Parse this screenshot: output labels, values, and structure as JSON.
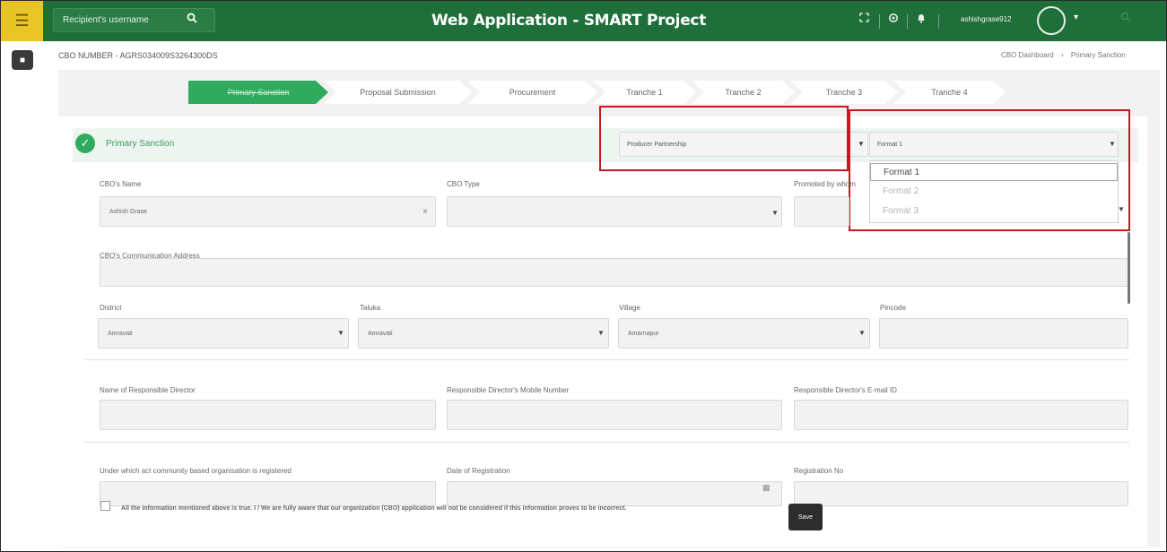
{
  "header": {
    "menu_icon": "hamburger-icon",
    "search_placeholder": "Recipient's username",
    "search_icon": "search-icon",
    "title": "Web Application - SMART Project",
    "icons": [
      "expand-icon",
      "settings-icon",
      "bell-icon"
    ],
    "username": "ashishgrase912",
    "brand_color": "#1f6f3a",
    "accent_color": "#e8c424"
  },
  "page": {
    "cbo_number": "CBO NUMBER - AGRS034009S3264300DS",
    "breadcrumb": [
      "CBO Dashboard",
      "Primary Sanction"
    ],
    "breadcrumb_sep": "›"
  },
  "stepper": {
    "steps": [
      {
        "label": "Primary Sanction",
        "active": true
      },
      {
        "label": "Proposal Submission",
        "active": false
      },
      {
        "label": "Procurement",
        "active": false
      },
      {
        "label": "Tranche 1",
        "active": false
      },
      {
        "label": "Tranche 2",
        "active": false
      },
      {
        "label": "Tranche 3",
        "active": false
      },
      {
        "label": "Tranche 4",
        "active": false
      }
    ]
  },
  "section": {
    "title": "Primary Sanction",
    "org_type_value": "Producer Partnership",
    "format_value": "Format 1",
    "format_options": [
      "Format 1",
      "Format 2",
      "Format 3"
    ]
  },
  "form": {
    "cbo_name_label": "CBO's Name",
    "cbo_name_value": "Ashish Grase",
    "clear_icon": "×",
    "cbo_type_label": "CBO Type",
    "promoted_by_label": "Promoted by whom",
    "address_label": "CBO's Communication Address",
    "district_label": "District",
    "district_value": "Amravati",
    "taluka_label": "Taluka",
    "taluka_value": "Amravati",
    "village_label": "Village",
    "village_value": "Amarnapur",
    "pincode_label": "Pincode",
    "director_name_label": "Name of Responsible Director",
    "director_mobile_label": "Responsible Director's Mobile Number",
    "director_email_label": "Responsible Director's E-mail ID",
    "act_label": "Under which act community based organisation is registered",
    "reg_date_label": "Date of Registration",
    "reg_no_label": "Registration No"
  },
  "footer": {
    "declaration": "All the information mentioned above is true. I / We are fully aware that our organization (CBO) application will not be considered if this information proves to be incorrect.",
    "save_label": "Save"
  }
}
